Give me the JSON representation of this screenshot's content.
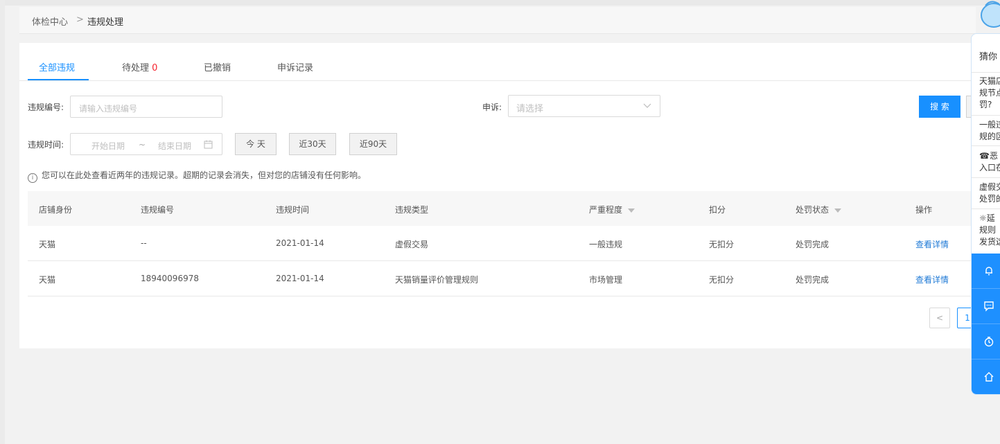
{
  "breadcrumb": {
    "root": "体检中心",
    "sep": ">",
    "current": "违规处理"
  },
  "tabs": [
    {
      "label": "全部违规",
      "count": ""
    },
    {
      "label": "待处理",
      "count": "0"
    },
    {
      "label": "已撤销",
      "count": ""
    },
    {
      "label": "申诉记录",
      "count": ""
    }
  ],
  "filters": {
    "violation_no_label": "违规编号:",
    "violation_no_placeholder": "请输入违规编号",
    "appeal_label": "申诉:",
    "appeal_placeholder": "请选择",
    "search_button": "搜 索",
    "time_label": "违规时间:",
    "start_placeholder": "开始日期",
    "range_sep": "~",
    "end_placeholder": "结束日期",
    "quick_today": "今 天",
    "quick_30": "近30天",
    "quick_90": "近90天"
  },
  "notice": "您可以在此处查看近两年的违规记录。超期的记录会消失，但对您的店铺没有任何影响。",
  "table": {
    "columns": [
      "店铺身份",
      "违规编号",
      "违规时间",
      "违规类型",
      "严重程度",
      "扣分",
      "处罚状态",
      "操作"
    ],
    "rows": [
      {
        "shop": "天猫",
        "no": "--",
        "time": "2021-01-14",
        "type": "虚假交易",
        "severity": "一般违规",
        "points": "无扣分",
        "status": "处罚完成",
        "action": "查看详情"
      },
      {
        "shop": "天猫",
        "no": "18940096978",
        "time": "2021-01-14",
        "type": "天猫销量评价管理规则",
        "severity": "市场管理",
        "points": "无扣分",
        "status": "处罚完成",
        "action": "查看详情"
      }
    ]
  },
  "pagination": {
    "prev": "<",
    "current": "1"
  },
  "side_panel": {
    "title": "猜你",
    "items": [
      "天猫店\n规节点\n罚?",
      "一般违\n规的区",
      "☎恶\n入口在",
      "虚假交\n处罚的",
      "☼延\n规则\n发货这"
    ],
    "icons": [
      "bell-icon",
      "chat-icon",
      "timer-icon",
      "home-icon"
    ]
  },
  "colors": {
    "primary": "#1890ff",
    "danger": "#f5222d",
    "link": "#1f7ad6"
  }
}
